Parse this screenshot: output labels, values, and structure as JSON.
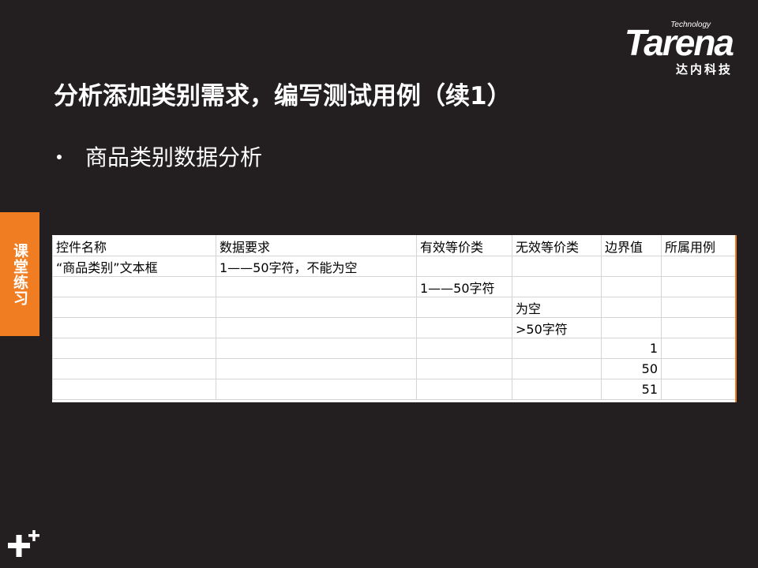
{
  "logo": {
    "tagline": "Technology",
    "brand": "Tarena",
    "chinese": "达内科技"
  },
  "title": "分析添加类别需求，编写测试用例（续1）",
  "bullet": "商品类别数据分析",
  "side_tab": "课堂练习",
  "table": {
    "headers": [
      "控件名称",
      "数据要求",
      "有效等价类",
      "无效等价类",
      "边界值",
      "所属用例"
    ],
    "rows": [
      [
        "“商品类别”文本框",
        "1——50字符，不能为空",
        "",
        "",
        "",
        ""
      ],
      [
        "",
        "",
        "1——50字符",
        "",
        "",
        ""
      ],
      [
        "",
        "",
        "",
        "为空",
        "",
        ""
      ],
      [
        "",
        "",
        "",
        ">50字符",
        "",
        ""
      ],
      [
        "",
        "",
        "",
        "",
        "1",
        ""
      ],
      [
        "",
        "",
        "",
        "",
        "50",
        ""
      ],
      [
        "",
        "",
        "",
        "",
        "51",
        ""
      ]
    ]
  },
  "colors": {
    "background": "#231f20",
    "accent": "#f07d22"
  },
  "icons": {
    "bottom_left": "plus-icon"
  }
}
